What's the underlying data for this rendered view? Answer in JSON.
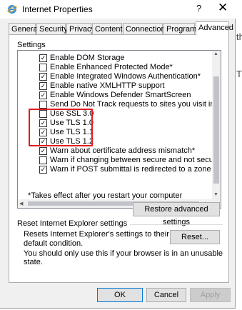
{
  "background": {
    "partial_text": [
      "the",
      "T"
    ]
  },
  "window": {
    "title": "Internet Properties",
    "help": "?",
    "close": "✕"
  },
  "tabs": [
    {
      "label": "General"
    },
    {
      "label": "Security"
    },
    {
      "label": "Privacy"
    },
    {
      "label": "Content"
    },
    {
      "label": "Connections"
    },
    {
      "label": "Programs"
    },
    {
      "label": "Advanced",
      "active": true
    }
  ],
  "settings": {
    "label": "Settings",
    "items": [
      {
        "label": "Enable DOM Storage",
        "checked": true
      },
      {
        "label": "Enable Enhanced Protected Mode*",
        "checked": false
      },
      {
        "label": "Enable Integrated Windows Authentication*",
        "checked": true
      },
      {
        "label": "Enable native XMLHTTP support",
        "checked": true
      },
      {
        "label": "Enable Windows Defender SmartScreen",
        "checked": true
      },
      {
        "label": "Send Do Not Track requests to sites you visit in Internet E",
        "checked": false
      },
      {
        "label": "Use SSL 3.0",
        "checked": false
      },
      {
        "label": "Use TLS 1.0",
        "checked": true
      },
      {
        "label": "Use TLS 1.1",
        "checked": true
      },
      {
        "label": "Use TLS 1.2",
        "checked": true
      },
      {
        "label": "Warn about certificate address mismatch*",
        "checked": true
      },
      {
        "label": "Warn if changing between secure and not secure mode",
        "checked": false
      },
      {
        "label": "Warn if POST submittal is redirected to a zone that does n",
        "checked": true
      }
    ],
    "note": "*Takes effect after you restart your computer",
    "restore_button": "Restore advanced settings"
  },
  "reset": {
    "group_title": "Reset Internet Explorer settings",
    "description": "Resets Internet Explorer's settings to their default condition.",
    "button": "Reset...",
    "warning": "You should only use this if your browser is in an unusable state."
  },
  "footer": {
    "ok": "OK",
    "cancel": "Cancel",
    "apply": "Apply"
  },
  "colors": {
    "highlight": "#e31c1c",
    "accent": "#0078d7"
  }
}
